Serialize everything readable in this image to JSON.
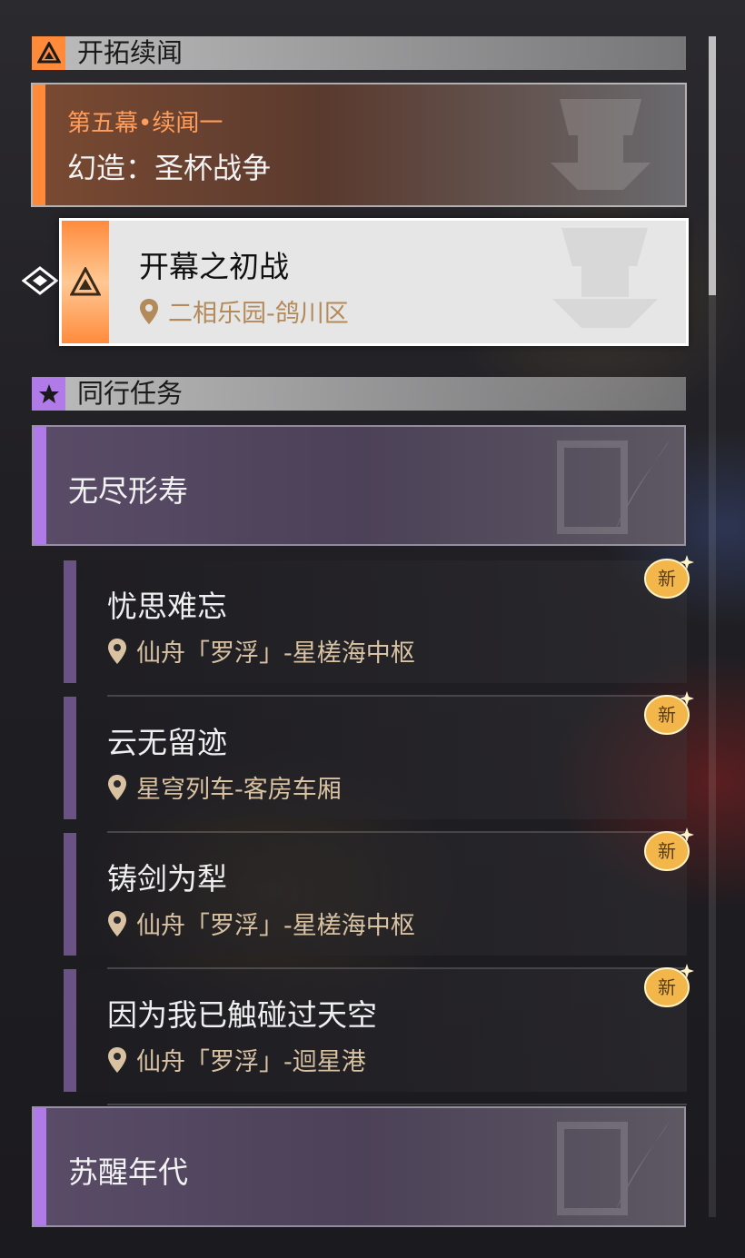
{
  "sections": {
    "trailblaze": {
      "title": "开拓续闻",
      "icon": "trailblaze-triangle-icon"
    },
    "companion": {
      "title": "同行任务",
      "icon": "star-icon"
    }
  },
  "main_quest": {
    "kicker": "第五幕•续闻一",
    "title": "幻造：圣杯战争"
  },
  "selected_quest": {
    "title": "开幕之初战",
    "location": "二相乐园-鸽川区"
  },
  "groups": [
    {
      "title": "无尽形寿"
    },
    {
      "title": "苏醒年代"
    }
  ],
  "quests": [
    {
      "title": "忧思难忘",
      "location": "仙舟「罗浮」-星槎海中枢",
      "badge": "新"
    },
    {
      "title": "云无留迹",
      "location": "星穹列车-客房车厢",
      "badge": "新"
    },
    {
      "title": "铸剑为犁",
      "location": "仙舟「罗浮」-星槎海中枢",
      "badge": "新"
    },
    {
      "title": "因为我已触碰过天空",
      "location": "仙舟「罗浮」-迴星港",
      "badge": "新"
    }
  ],
  "colors": {
    "trailblaze_accent": "#ff8a3a",
    "companion_accent": "#b07ae8",
    "location_gold": "#d8c2a2",
    "new_badge": "#f2b64a"
  }
}
